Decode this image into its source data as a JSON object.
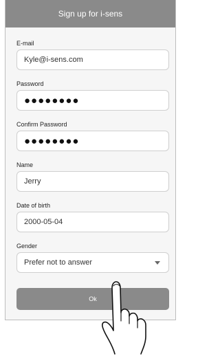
{
  "header": {
    "title": "Sign up for i-sens"
  },
  "form": {
    "email": {
      "label": "E-mail",
      "value": "Kyle@i-sens.com"
    },
    "password": {
      "label": "Password",
      "value": "●●●●●●●●"
    },
    "confirm_password": {
      "label": "Confirm Password",
      "value": "●●●●●●●●"
    },
    "name": {
      "label": "Name",
      "value": "Jerry"
    },
    "dob": {
      "label": "Date of birth",
      "value": "2000-05-04"
    },
    "gender": {
      "label": "Gender",
      "value": "Prefer not to answer"
    }
  },
  "actions": {
    "ok_label": "Ok"
  },
  "icons": {
    "hand": "hand-pointer-icon",
    "dropdown": "chevron-down-icon"
  },
  "colors": {
    "header": "#8a8a8a",
    "button": "#8a8a8a"
  }
}
